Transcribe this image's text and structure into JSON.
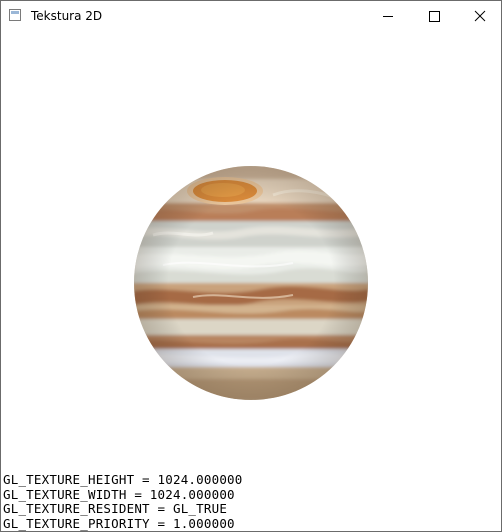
{
  "window": {
    "title": "Tekstura 2D"
  },
  "titlebar_icons": {
    "app": "app-window-icon",
    "minimize": "minimize-icon",
    "maximize": "maximize-icon",
    "close": "close-icon"
  },
  "scene": {
    "object": "jupiter-textured-sphere-icon",
    "colors": {
      "background": "#ffffff",
      "band_light": "#dcdfdc",
      "band_tan": "#c9a27c",
      "band_brown": "#a66a45",
      "great_red_spot": "#d98a3a"
    }
  },
  "texture_info": [
    "GL_TEXTURE_HEIGHT = 1024.000000",
    "GL_TEXTURE_WIDTH = 1024.000000",
    "GL_TEXTURE_RESIDENT = GL_TRUE",
    "GL_TEXTURE_PRIORITY = 1.000000"
  ]
}
